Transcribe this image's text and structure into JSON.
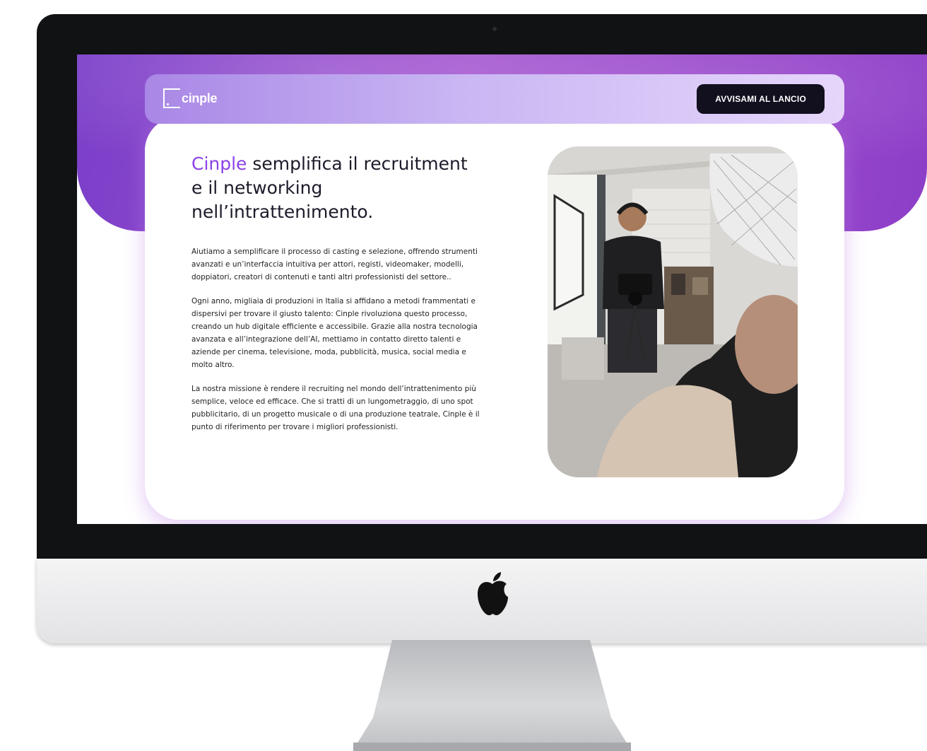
{
  "navbar": {
    "logo_text": "cinple",
    "notify_button_label": "AVVISAMI AL LANCIO"
  },
  "hero": {
    "headline_brand": "Cinple",
    "headline_rest": " semplifica il recruitment e il networking nell’intrattenimento.",
    "paragraphs": [
      "Aiutiamo a semplificare il processo di casting e selezione, offrendo strumenti avanzati e un’interfaccia intuitiva per attori, registi, videomaker, modelli, doppiatori, creatori di contenuti e tanti altri professionisti del settore..",
      "Ogni anno, migliaia di produzioni in Italia si affidano a metodi frammentati e dispersivi per trovare il giusto talento: Cinple rivoluziona questo processo, creando un hub digitale efficiente e accessibile. Grazie alla nostra tecnologia avanzata e all’integrazione dell’AI, mettiamo in contatto diretto talenti e aziende per cinema, televisione, moda, pubblicità, musica, social media e molto altro.",
      "La nostra missione è rendere il recruiting nel mondo dell’intrattenimento più semplice, veloce ed efficace. Che si tratti di un lungometraggio, di uno spot pubblicitario, di un progetto musicale o di una produzione teatrale, Cinple è il punto di riferimento per trovare i migliori professionisti."
    ],
    "image_icon": "camera-operator-photo"
  },
  "device": {
    "logo_icon": "apple-logo-icon"
  },
  "colors": {
    "brand_purple": "#8b42e8",
    "hero_gradient_start": "#7b3fc9",
    "button_dark": "#120f1f"
  }
}
